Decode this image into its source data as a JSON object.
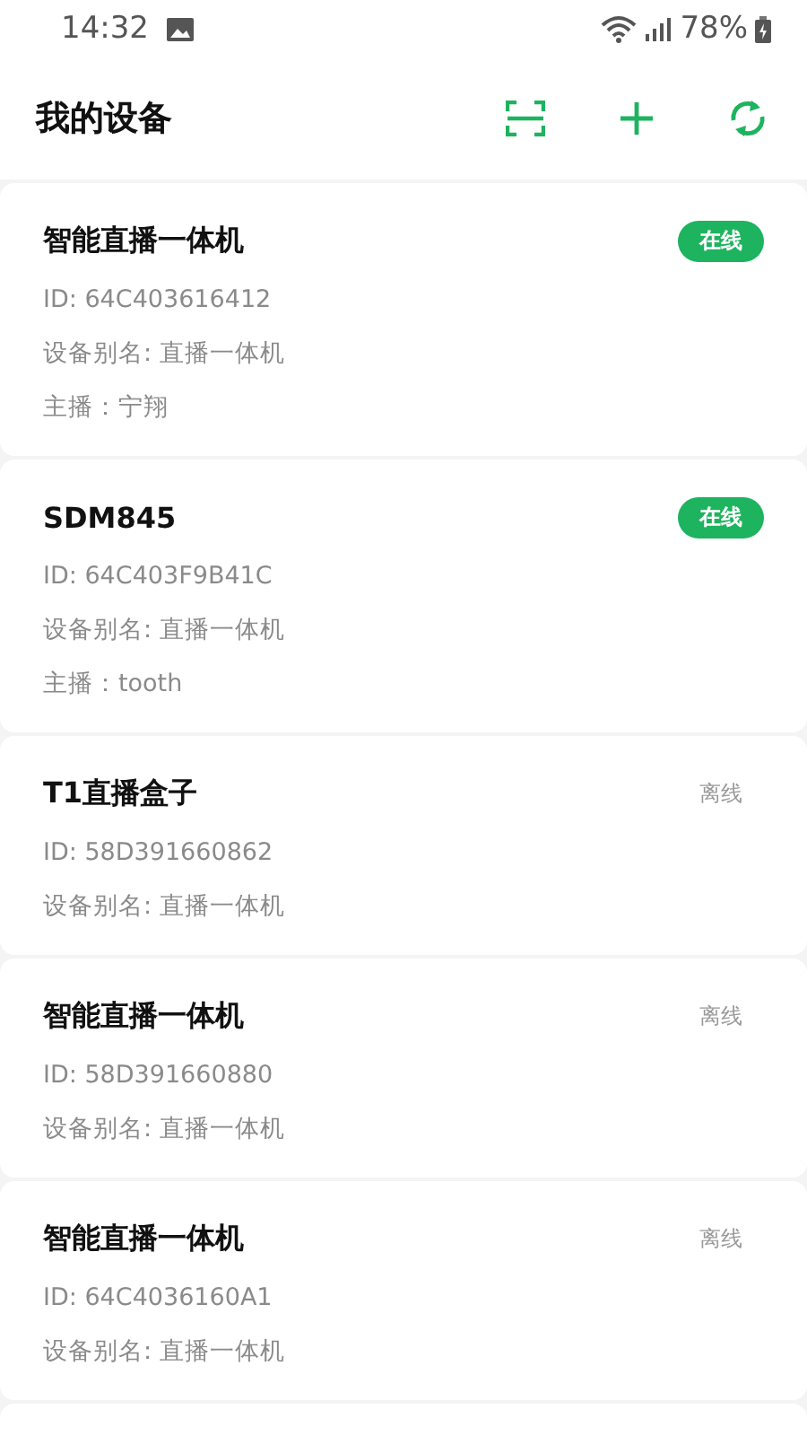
{
  "status_bar": {
    "time": "14:32",
    "battery": "78%"
  },
  "header": {
    "title": "我的设备"
  },
  "devices": [
    {
      "name": "智能直播一体机",
      "online": true,
      "status": "在线",
      "id": "ID: 64C403616412",
      "alias": "设备别名: 直播一体机",
      "host": "主播：宁翔"
    },
    {
      "name": "SDM845",
      "online": true,
      "status": "在线",
      "id": "ID: 64C403F9B41C",
      "alias": "设备别名: 直播一体机",
      "host": "主播：tooth"
    },
    {
      "name": "T1直播盒子",
      "online": false,
      "status": "离线",
      "id": "ID: 58D391660862",
      "alias": "设备别名: 直播一体机"
    },
    {
      "name": "智能直播一体机",
      "online": false,
      "status": "离线",
      "id": "ID: 58D391660880",
      "alias": "设备别名: 直播一体机"
    },
    {
      "name": "智能直播一体机",
      "online": false,
      "status": "离线",
      "id": "ID: 64C4036160A1",
      "alias": "设备别名: 直播一体机"
    }
  ]
}
